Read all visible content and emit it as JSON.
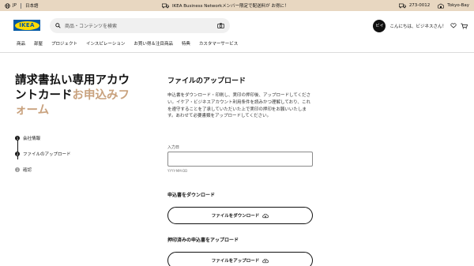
{
  "topbar": {
    "language_code": "JP",
    "language_name": "日本語",
    "business_notice": "IKEA Business Networkメンバー限定で配送料が お得に！",
    "postal_code": "273-0012",
    "store_name": "Tokyo-Bay"
  },
  "header": {
    "logo_text": "IKEA",
    "search_placeholder": "商品・コンテンツを検索",
    "avatar_initials": "ビイ",
    "greeting": "こんにちは、ビジネスさん！"
  },
  "nav": {
    "items": [
      "商品",
      "部屋",
      "プロジェクト",
      "インスピレーション",
      "お買い得＆注目商品",
      "特典",
      "カスタマーサービス"
    ]
  },
  "left": {
    "title_main": "請求書払い専用アカウントカード",
    "title_accent": "お申込みフォーム",
    "steps": [
      {
        "number": "1",
        "label": "会社情報"
      },
      {
        "number": "2",
        "label": "ファイルのアップロード"
      },
      {
        "number": "3",
        "label": "確認"
      }
    ]
  },
  "main": {
    "section_title": "ファイルのアップロード",
    "description": "申込書をダウンロード・印刷し、実印の押印後、アップロードしてください。イケア・ビジネスアカウント利用条件を読みかつ理解しており、これを遵守することを了承していただいた上で実印の押印をお願いいたします。あわせて必要書類をアップロードしてください。",
    "date_label": "入力日",
    "date_hint": "YYYY-MM-DD",
    "download_title": "申込書をダウンロード",
    "download_button": "ファイルをダウンロード",
    "upload_title": "押印済みの申込書をアップロード",
    "upload_button": "ファイルをアップロード"
  },
  "colors": {
    "topbar_bg": "#e8d7c1",
    "accent_text": "#c9a27e",
    "ikea_blue": "#0058a3",
    "ikea_yellow": "#ffdb00"
  }
}
